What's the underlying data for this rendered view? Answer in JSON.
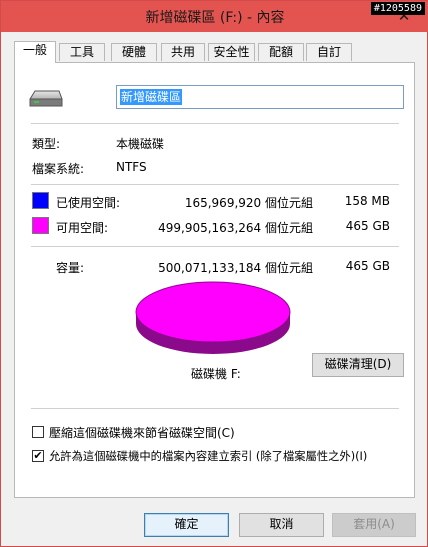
{
  "window": {
    "title": "新增磁碟區 (F:) - 內容",
    "close_glyph": "✕",
    "badge": "#1205589"
  },
  "tabs": [
    {
      "label": "一般",
      "active": true
    },
    {
      "label": "工具"
    },
    {
      "label": "硬體"
    },
    {
      "label": "共用"
    },
    {
      "label": "安全性"
    },
    {
      "label": "配額"
    },
    {
      "label": "自訂"
    }
  ],
  "general": {
    "icon": "drive-icon",
    "volume_name": "新增磁碟區",
    "type_label": "類型:",
    "type_value": "本機磁碟",
    "fs_label": "檔案系統:",
    "fs_value": "NTFS",
    "used": {
      "label": "已使用空間:",
      "bytes": "165,969,920 個位元組",
      "size": "158 MB",
      "color": "#0000ff"
    },
    "free": {
      "label": "可用空間:",
      "bytes": "499,905,163,264 個位元組",
      "size": "465 GB",
      "color": "#ff00ff"
    },
    "capacity": {
      "label": "容量:",
      "bytes": "500,071,133,184 個位元組",
      "size": "465 GB"
    },
    "drive_label": "磁碟機 F:",
    "cleanup_button": "磁碟清理(D)",
    "compress_option": {
      "label": "壓縮這個磁碟機來節省磁碟空間(C)",
      "checked": false
    },
    "index_option": {
      "label": "允許為這個磁碟機中的檔案內容建立索引 (除了檔案屬性之外)(I)",
      "checked": true,
      "check_glyph": "✔"
    }
  },
  "buttons": {
    "ok": "確定",
    "cancel": "取消",
    "apply": "套用(A)"
  }
}
